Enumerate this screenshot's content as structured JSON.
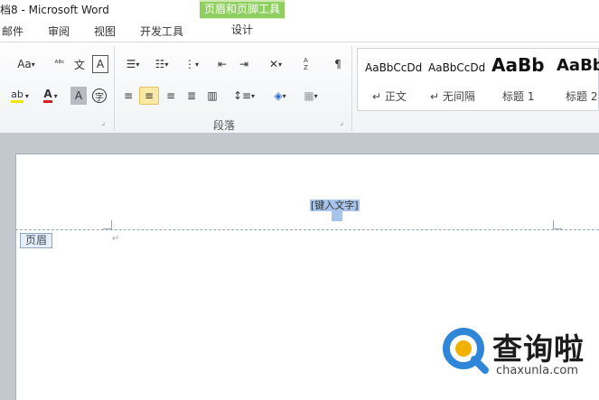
{
  "window": {
    "title": "档8 - Microsoft Word"
  },
  "context_tool": {
    "title": "页眉和页脚工具",
    "tab": "设计"
  },
  "tabs": [
    "邮件",
    "审阅",
    "视图",
    "开发工具"
  ],
  "ribbon": {
    "font_group": {
      "size_button": "Aa",
      "font_color_letter": "A",
      "highlight_letter": "ab",
      "char_shading_letter": "A",
      "enclose_char": "字",
      "phonetic": "文",
      "border_letter": "A"
    },
    "paragraph_group": {
      "label": "段落",
      "sort_label": "A Z",
      "show_marks": "¶"
    },
    "styles_group": {
      "items": [
        {
          "sample": "AaBbCcDd",
          "name": "↵ 正文"
        },
        {
          "sample": "AaBbCcDd",
          "name": "↵ 无间隔"
        },
        {
          "sample": "AaBb",
          "name": "标题 1"
        },
        {
          "sample": "AaBb",
          "name": "标题 2"
        }
      ]
    }
  },
  "document": {
    "header_placeholder": "[键入文字]",
    "header_tag": "页眉",
    "paragraph_mark": "↵"
  },
  "watermark": {
    "text": "查询啦",
    "url": "chaxunla.com"
  },
  "colors": {
    "context_green": "#8fcf5f",
    "highlight": "#a7c4ea",
    "active_button": "#fbe9a6"
  }
}
